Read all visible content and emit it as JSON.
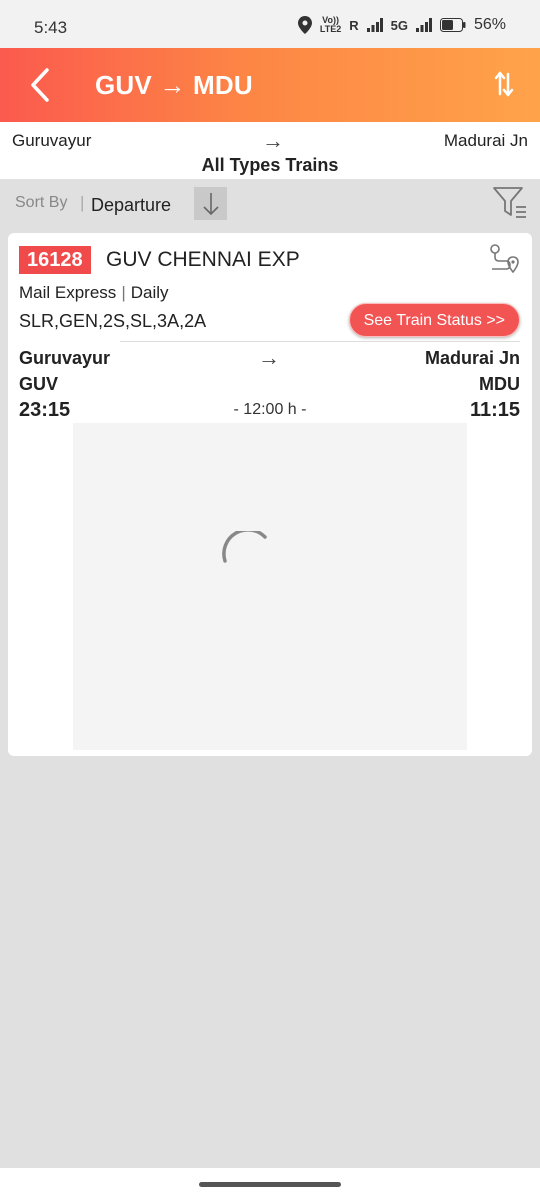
{
  "status_bar": {
    "time": "5:43",
    "volte_top": "Vo))",
    "volte_bottom": "LTE2",
    "roaming": "R",
    "network": "5G",
    "battery_pct": "56%"
  },
  "app_bar": {
    "title": "GUV → MDU",
    "back_icon": "chevron-left-icon",
    "swap_icon": "swap-vertical-icon"
  },
  "route": {
    "from": "Guruvayur",
    "arrow": "→",
    "to": "Madurai Jn",
    "train_types": "All Types Trains"
  },
  "sort": {
    "label": "Sort By",
    "separator": "|",
    "value": "Departure",
    "direction_icon": "arrow-down-icon",
    "filter_icon": "filter-icon"
  },
  "train": {
    "number": "16128",
    "name": "GUV CHENNAI EXP",
    "type": "Mail Express",
    "separator": "|",
    "frequency": "Daily",
    "classes": "SLR,GEN,2S,SL,3A,2A",
    "status_button": "See Train Status  >>",
    "departure": {
      "station": "Guruvayur",
      "code": "GUV",
      "time": "23:15"
    },
    "arrow": "→",
    "duration": "- 12:00 h -",
    "arrival": {
      "station": "Madurai Jn",
      "code": "MDU",
      "time": "11:15"
    }
  },
  "colors": {
    "header_start": "#fb5a4e",
    "header_end": "#ffa34a",
    "train_number_bg": "#f04a4a",
    "status_button_bg": "#f25454"
  }
}
